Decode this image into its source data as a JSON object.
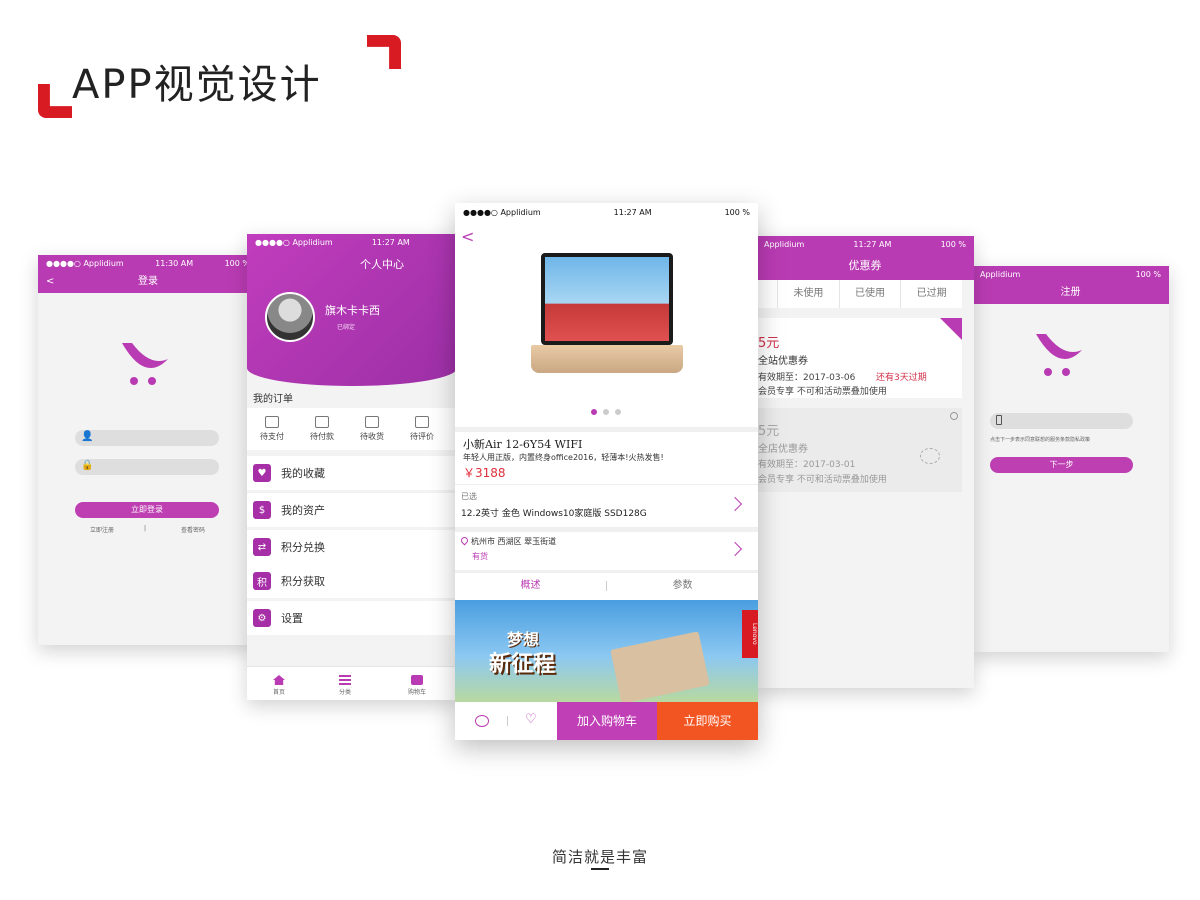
{
  "header": {
    "title": "APP视觉设计"
  },
  "login": {
    "status": {
      "carrier": "●●●●○ Applidium",
      "time": "11:30 AM",
      "battery": "100 %"
    },
    "title": "登录",
    "back": "<",
    "login_button": "立即登录",
    "register_link": "立即注册",
    "divider": "|",
    "forgot_link": "查看密码"
  },
  "profile": {
    "status": {
      "carrier": "●●●●○ Applidium",
      "time": "11:27 AM",
      "battery": ""
    },
    "title": "个人中心",
    "username": "旗木卡卡西",
    "bound": "已绑定",
    "orders_header": "我的订单",
    "orders": [
      {
        "label": "待支付"
      },
      {
        "label": "待付款"
      },
      {
        "label": "待收货"
      },
      {
        "label": "待评价"
      }
    ],
    "menu": [
      {
        "label": "我的收藏",
        "icon": "♥"
      },
      {
        "label": "我的资产",
        "icon": "$"
      },
      {
        "label": "积分兑换",
        "icon": "⇄"
      },
      {
        "label": "积分获取",
        "icon": "积"
      },
      {
        "label": "设置",
        "icon": "⚙"
      }
    ],
    "tabs": [
      {
        "label": "首页"
      },
      {
        "label": "分类"
      },
      {
        "label": "购物车"
      }
    ]
  },
  "product": {
    "status": {
      "carrier": "●●●●○ Applidium",
      "time": "11:27 AM",
      "battery": "100 %"
    },
    "back": "<",
    "name": "小新Air 12-6Y54 WIFI",
    "promo": "年轻人用正版，内置终身office2016，轻薄本!火热发售!",
    "price": "￥3188",
    "selected_label": "已选",
    "selected_spec": "12.2英寸  金色  Windows10家庭版  SSD128G",
    "location": "杭州市  西湖区  翠玉街道",
    "stock": "有货",
    "tab_overview": "概述",
    "tab_params": "参数",
    "banner_title_1": "梦想",
    "banner_title_2": "新征程",
    "banner_brand": "Lenovo",
    "add_to_cart": "加入购物车",
    "buy_now": "立即购买"
  },
  "coupon": {
    "status": {
      "carrier": "Applidium",
      "time": "11:27 AM",
      "battery": "100 %"
    },
    "title": "优惠券",
    "tabs": [
      "未使用",
      "已使用",
      "已过期"
    ],
    "items": [
      {
        "amount": "5元",
        "name": "全站优惠券",
        "valid": "有效期至：2017-03-06",
        "warn": "还有3天过期",
        "note": "会员专享  不可和活动票叠加使用"
      },
      {
        "amount": "5元",
        "name": "全店优惠券",
        "valid": "有效期至：2017-03-01",
        "warn": "",
        "note": "会员专享  不可和活动票叠加使用"
      }
    ]
  },
  "register": {
    "status": {
      "carrier": "Applidium",
      "time": "",
      "battery": "100 %"
    },
    "title": "注册",
    "hint": "点击下一步表示同意联想的服务条款隐私政策",
    "next_button": "下一步"
  },
  "footer": {
    "slogan": "简洁就是丰富"
  },
  "colors": {
    "accent": "#b93bb3",
    "brand_red": "#d81a23",
    "buy_orange": "#f25522"
  }
}
